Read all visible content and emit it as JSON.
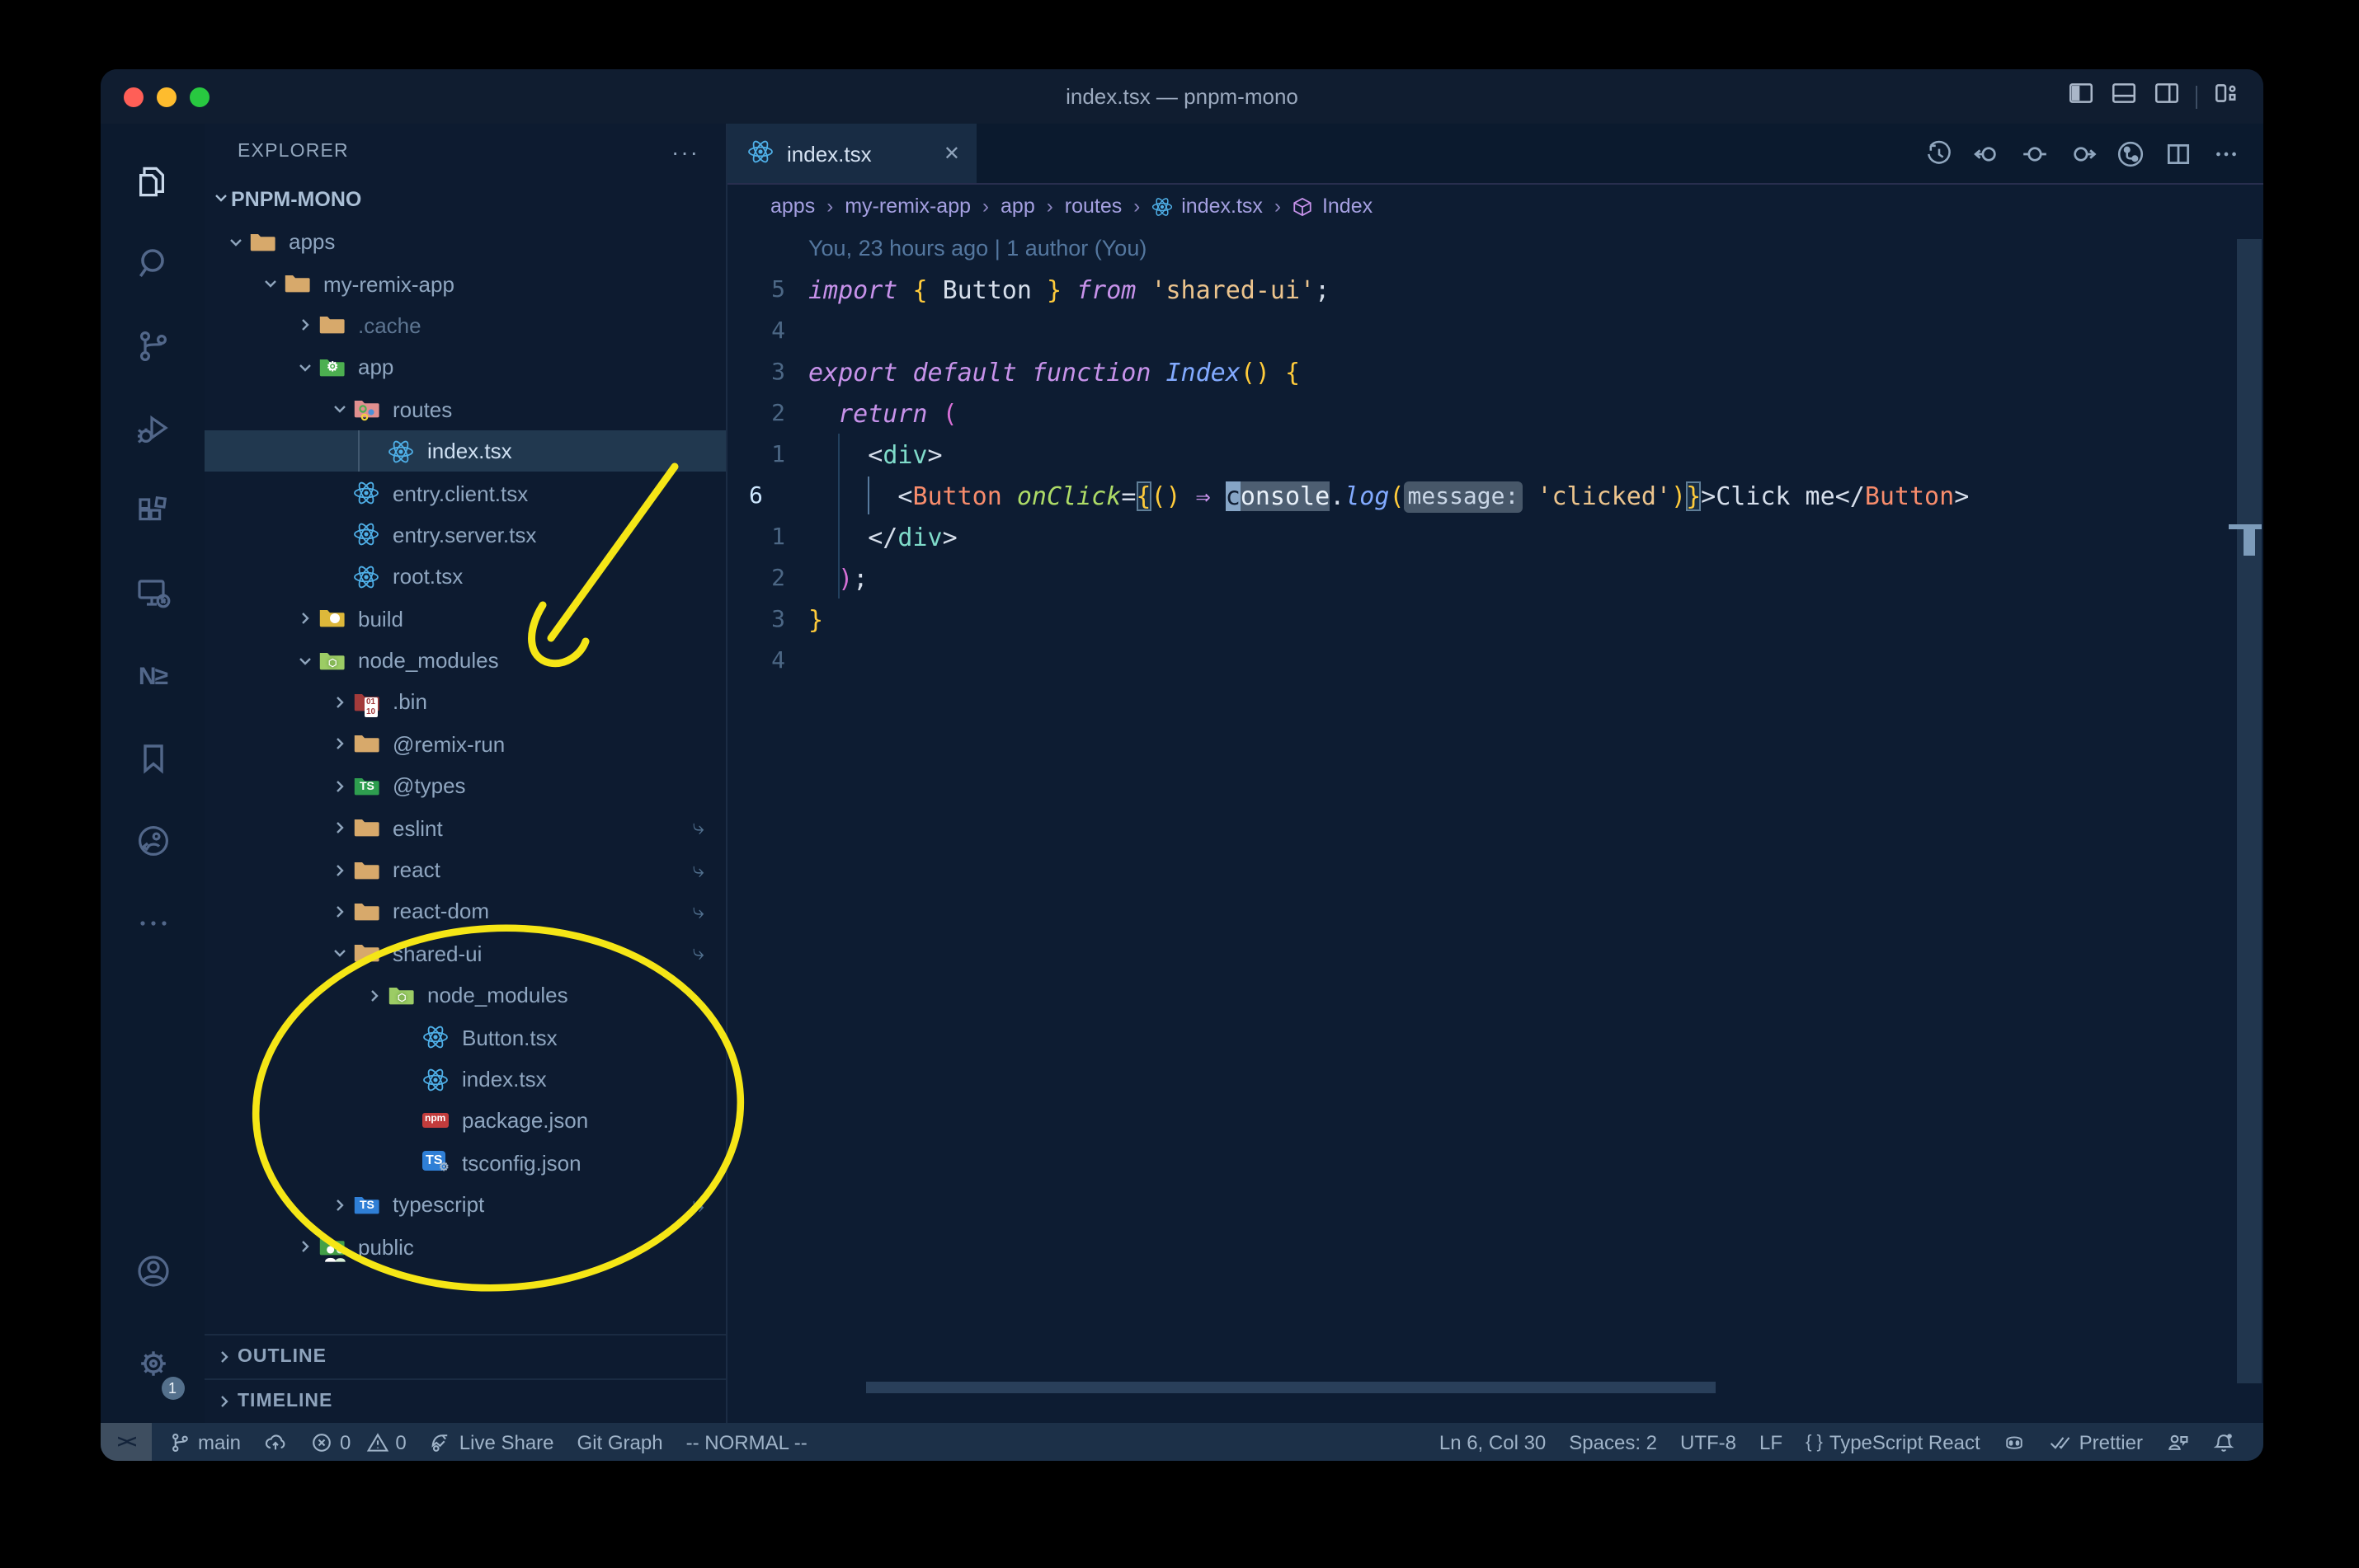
{
  "window": {
    "title": "index.tsx — pnpm-mono",
    "traffic_lights": [
      "close",
      "minimize",
      "zoom"
    ],
    "layout_buttons": [
      "toggle-sidebar",
      "toggle-panel",
      "toggle-secondary-sidebar",
      "customize-layout"
    ]
  },
  "colors": {
    "annotation_yellow": "#f5e616",
    "editor_bg": "#0d1c32",
    "selection_bg": "#21384f",
    "statusbar_bg": "#1c3048",
    "keyword": "#c792ea",
    "function": "#82aaff",
    "component": "#f78c6c",
    "tag": "#7fdbca",
    "attribute": "#addb67",
    "string": "#ecc48d",
    "bracket_gold": "#ffcb3b",
    "bracket_orchid": "#d670d6",
    "react_icon_blue": "#4fb0e8"
  },
  "activity_bar": {
    "items": [
      {
        "name": "explorer",
        "active": true
      },
      {
        "name": "search"
      },
      {
        "name": "source-control"
      },
      {
        "name": "run-debug"
      },
      {
        "name": "extensions"
      },
      {
        "name": "remote-explorer"
      },
      {
        "name": "nx-console",
        "glyph": "N≥"
      },
      {
        "name": "bookmarks"
      },
      {
        "name": "live-share"
      },
      {
        "name": "more"
      }
    ],
    "bottom": [
      {
        "name": "account"
      },
      {
        "name": "settings",
        "badge": "1"
      }
    ]
  },
  "explorer": {
    "header": "EXPLORER",
    "header_more": "···",
    "root": "PNPM-MONO",
    "tree": [
      {
        "label": "apps",
        "icon": "folder",
        "chevron": "open",
        "depth": 0
      },
      {
        "label": "my-remix-app",
        "icon": "folder",
        "chevron": "open",
        "depth": 1
      },
      {
        "label": ".cache",
        "icon": "folder",
        "chevron": "closed",
        "depth": 2,
        "dim": true
      },
      {
        "label": "app",
        "icon": "folder-app",
        "chevron": "open",
        "depth": 2
      },
      {
        "label": "routes",
        "icon": "folder-routes",
        "chevron": "open",
        "depth": 3
      },
      {
        "label": "index.tsx",
        "icon": "react",
        "depth": 4,
        "selected": true
      },
      {
        "label": "entry.client.tsx",
        "icon": "react",
        "depth": 3
      },
      {
        "label": "entry.server.tsx",
        "icon": "react",
        "depth": 3
      },
      {
        "label": "root.tsx",
        "icon": "react",
        "depth": 3
      },
      {
        "label": "build",
        "icon": "folder-build",
        "chevron": "closed",
        "depth": 2
      },
      {
        "label": "node_modules",
        "icon": "folder-node",
        "chevron": "open",
        "depth": 2
      },
      {
        "label": ".bin",
        "icon": "folder-bin",
        "chevron": "closed",
        "depth": 3
      },
      {
        "label": "@remix-run",
        "icon": "folder",
        "chevron": "closed",
        "depth": 3
      },
      {
        "label": "@types",
        "icon": "folder-types",
        "chevron": "closed",
        "depth": 3
      },
      {
        "label": "eslint",
        "icon": "folder",
        "chevron": "closed",
        "depth": 3,
        "symlink": true
      },
      {
        "label": "react",
        "icon": "folder",
        "chevron": "closed",
        "depth": 3,
        "symlink": true
      },
      {
        "label": "react-dom",
        "icon": "folder",
        "chevron": "closed",
        "depth": 3,
        "symlink": true
      },
      {
        "label": "shared-ui",
        "icon": "folder",
        "chevron": "open",
        "depth": 3,
        "symlink": true
      },
      {
        "label": "node_modules",
        "icon": "folder-node",
        "chevron": "closed",
        "depth": 4
      },
      {
        "label": "Button.tsx",
        "icon": "react",
        "depth": 5
      },
      {
        "label": "index.tsx",
        "icon": "react",
        "depth": 5
      },
      {
        "label": "package.json",
        "icon": "npm",
        "depth": 5
      },
      {
        "label": "tsconfig.json",
        "icon": "ts-config",
        "depth": 5
      },
      {
        "label": "typescript",
        "icon": "folder-ts",
        "chevron": "closed",
        "depth": 3,
        "symlink": true
      },
      {
        "label": "public",
        "icon": "folder-public",
        "chevron": "closed",
        "depth": 2
      }
    ],
    "sections": [
      {
        "label": "OUTLINE"
      },
      {
        "label": "TIMELINE"
      }
    ]
  },
  "tab": {
    "label": "index.tsx",
    "icon": "react",
    "close": "✕"
  },
  "editor_actions": [
    "file-history",
    "navigate-back",
    "current-position",
    "navigate-forward",
    "git-graph",
    "split-editor",
    "more-actions"
  ],
  "breadcrumbs": [
    {
      "label": "apps"
    },
    {
      "label": "my-remix-app"
    },
    {
      "label": "app"
    },
    {
      "label": "routes"
    },
    {
      "label": "index.tsx",
      "icon": "react"
    },
    {
      "label": "Index",
      "icon": "symbol-module"
    }
  ],
  "editor": {
    "blame": "You, 23 hours ago | 1 author (You)",
    "lines": [
      {
        "num": "5",
        "tokens": [
          {
            "t": "import",
            "c": "kw"
          },
          {
            "t": " "
          },
          {
            "t": "{",
            "c": "gold"
          },
          {
            "t": " "
          },
          {
            "t": "Button"
          },
          {
            "t": " "
          },
          {
            "t": "}",
            "c": "gold"
          },
          {
            "t": " "
          },
          {
            "t": "from",
            "c": "kw"
          },
          {
            "t": " "
          },
          {
            "t": "'shared-ui'",
            "c": "str"
          },
          {
            "t": ";"
          }
        ]
      },
      {
        "num": "4",
        "tokens": []
      },
      {
        "num": "3",
        "tokens": [
          {
            "t": "export",
            "c": "kw"
          },
          {
            "t": " "
          },
          {
            "t": "default",
            "c": "kw"
          },
          {
            "t": " "
          },
          {
            "t": "function",
            "c": "kw"
          },
          {
            "t": " "
          },
          {
            "t": "Index",
            "c": "fn"
          },
          {
            "t": "(",
            "c": "gold"
          },
          {
            "t": ")",
            "c": "gold"
          },
          {
            "t": " "
          },
          {
            "t": "{",
            "c": "gold"
          }
        ]
      },
      {
        "num": "2",
        "tokens": [
          {
            "t": "  "
          },
          {
            "t": "return",
            "c": "kw"
          },
          {
            "t": " "
          },
          {
            "t": "(",
            "c": "orchid"
          }
        ]
      },
      {
        "num": "1",
        "tokens": [
          {
            "t": "    "
          },
          {
            "t": "<"
          },
          {
            "t": "div",
            "c": "tag"
          },
          {
            "t": ">"
          }
        ]
      },
      {
        "num": "6",
        "current": true,
        "tokens": [
          {
            "t": "      "
          },
          {
            "t": "<"
          },
          {
            "t": "Button",
            "c": "comp"
          },
          {
            "t": " "
          },
          {
            "t": "onClick",
            "c": "attr"
          },
          {
            "t": "="
          },
          {
            "t": "{",
            "c": "gold box"
          },
          {
            "t": "(",
            "c": "gold"
          },
          {
            "t": ")",
            "c": "gold"
          },
          {
            "t": " "
          },
          {
            "t": "⇒",
            "c": "kw"
          },
          {
            "t": " "
          },
          {
            "t": "c",
            "c": "cursor"
          },
          {
            "t": "onsole",
            "c": "hl"
          },
          {
            "t": "."
          },
          {
            "t": "log",
            "c": "fn"
          },
          {
            "t": "(",
            "c": "gold"
          },
          {
            "t": "message:",
            "c": "inlay"
          },
          {
            "t": " "
          },
          {
            "t": "'clicked'",
            "c": "str"
          },
          {
            "t": ")",
            "c": "gold"
          },
          {
            "t": "}",
            "c": "gold box"
          },
          {
            "t": ">"
          },
          {
            "t": "Click me"
          },
          {
            "t": "</"
          },
          {
            "t": "Button",
            "c": "comp"
          },
          {
            "t": ">"
          }
        ]
      },
      {
        "num": "1",
        "tokens": [
          {
            "t": "    "
          },
          {
            "t": "</"
          },
          {
            "t": "div",
            "c": "tag"
          },
          {
            "t": ">"
          }
        ]
      },
      {
        "num": "2",
        "tokens": [
          {
            "t": "  "
          },
          {
            "t": ")",
            "c": "orchid"
          },
          {
            "t": ";"
          }
        ]
      },
      {
        "num": "3",
        "tokens": [
          {
            "t": "}",
            "c": "gold"
          }
        ]
      },
      {
        "num": "4",
        "tokens": []
      }
    ]
  },
  "status_bar": {
    "left": [
      {
        "icon": "git-branch",
        "label": "main"
      },
      {
        "icon": "cloud-upload",
        "label": ""
      },
      {
        "icon": "error",
        "label": "0",
        "icon2": "warning",
        "label2": "0"
      },
      {
        "icon": "live-share",
        "label": "Live Share"
      },
      {
        "label": "Git Graph"
      },
      {
        "label": "-- NORMAL --"
      }
    ],
    "remote_glyph": "><",
    "right": [
      {
        "label": "Ln 6, Col 30"
      },
      {
        "label": "Spaces: 2"
      },
      {
        "label": "UTF-8"
      },
      {
        "label": "LF"
      },
      {
        "icon": "braces",
        "label": "TypeScript React"
      },
      {
        "icon": "copilot",
        "label": ""
      },
      {
        "icon": "double-check",
        "label": "Prettier"
      },
      {
        "icon": "feedback",
        "label": ""
      },
      {
        "icon": "bell-dot",
        "label": ""
      }
    ]
  },
  "annotations": [
    {
      "type": "arrow",
      "points_at": "node_modules"
    },
    {
      "type": "ellipse",
      "around": "shared-ui folder contents"
    }
  ]
}
